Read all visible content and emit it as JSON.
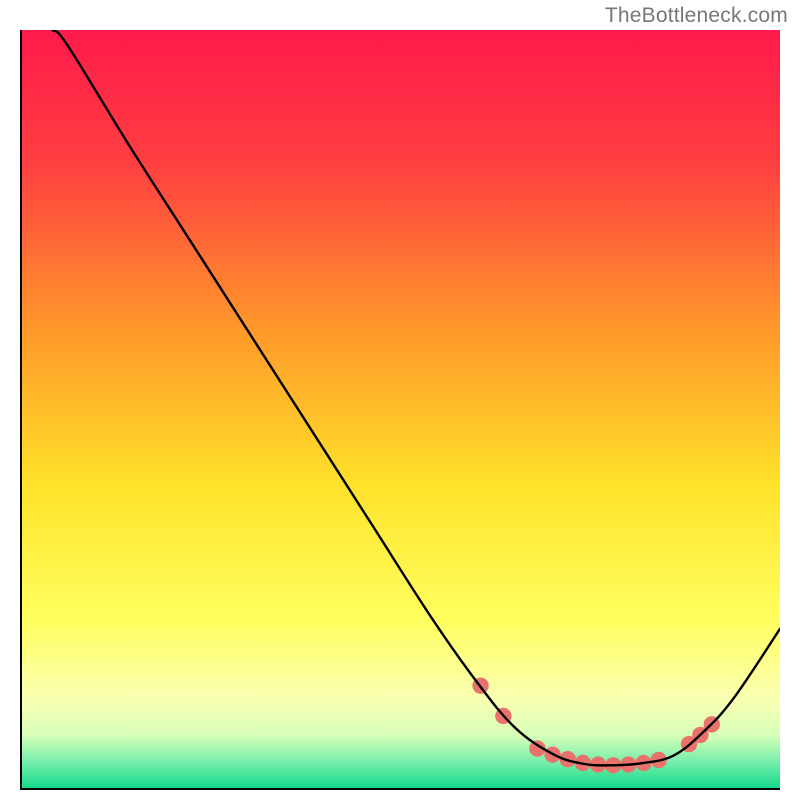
{
  "attribution": "TheBottleneck.com",
  "chart_data": {
    "type": "line",
    "title": "",
    "xlabel": "",
    "ylabel": "",
    "xlim": [
      0,
      100
    ],
    "ylim": [
      0,
      100
    ],
    "gradient_stops": [
      {
        "offset": 0.0,
        "color": "#ff1a4b"
      },
      {
        "offset": 0.18,
        "color": "#ff4040"
      },
      {
        "offset": 0.4,
        "color": "#ff9a2a"
      },
      {
        "offset": 0.6,
        "color": "#ffe22a"
      },
      {
        "offset": 0.78,
        "color": "#ffff60"
      },
      {
        "offset": 0.88,
        "color": "#faffb0"
      },
      {
        "offset": 0.93,
        "color": "#d8ffb8"
      },
      {
        "offset": 0.965,
        "color": "#78efac"
      },
      {
        "offset": 1.0,
        "color": "#14d98a"
      }
    ],
    "series": [
      {
        "name": "bottleneck-curve",
        "x": [
          4,
          6,
          14,
          22,
          30,
          38,
          46,
          54,
          60,
          65,
          70,
          74,
          78,
          82,
          86,
          90,
          94,
          100
        ],
        "y": [
          100,
          98,
          85,
          72.5,
          60,
          47.5,
          35,
          22.5,
          14,
          8,
          4.5,
          3.2,
          3.0,
          3.3,
          4.3,
          7.5,
          12,
          21
        ]
      }
    ],
    "markers": {
      "name": "highlighted-points",
      "color": "#e9736c",
      "radius": 8.2,
      "points": [
        {
          "x": 60.5,
          "y": 13.5
        },
        {
          "x": 63.5,
          "y": 9.5
        },
        {
          "x": 68,
          "y": 5.2
        },
        {
          "x": 70,
          "y": 4.4
        },
        {
          "x": 72,
          "y": 3.8
        },
        {
          "x": 74,
          "y": 3.3
        },
        {
          "x": 76,
          "y": 3.1
        },
        {
          "x": 78,
          "y": 3.0
        },
        {
          "x": 80,
          "y": 3.1
        },
        {
          "x": 82,
          "y": 3.3
        },
        {
          "x": 84,
          "y": 3.7
        },
        {
          "x": 88,
          "y": 5.8
        },
        {
          "x": 89.5,
          "y": 7.0
        },
        {
          "x": 91,
          "y": 8.4
        }
      ]
    }
  }
}
